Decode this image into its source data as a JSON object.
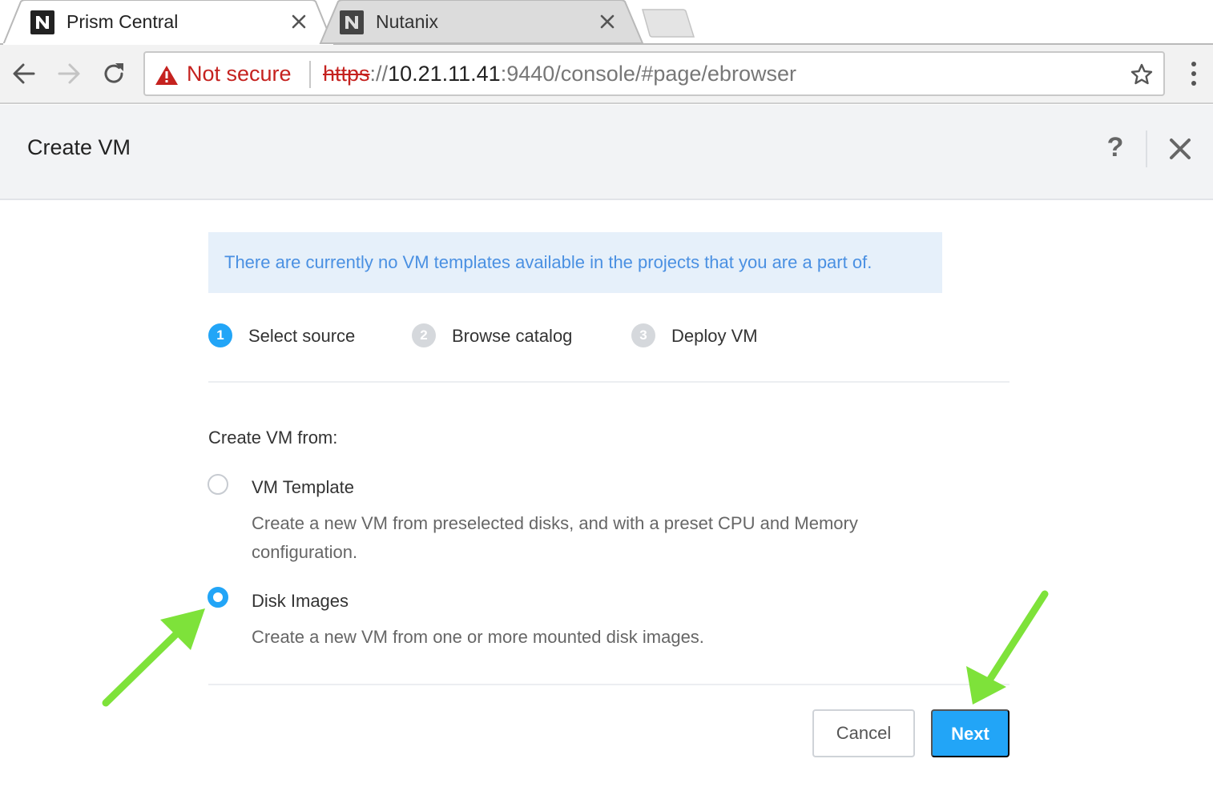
{
  "browser": {
    "tabs": [
      {
        "title": "Prism Central",
        "active": true
      },
      {
        "title": "Nutanix",
        "active": false
      }
    ],
    "omnibox": {
      "security_label": "Not secure",
      "url_scheme": "https",
      "url_sep": "://",
      "url_host": "10.21.11.41",
      "url_rest": ":9440/console/#page/ebrowser"
    }
  },
  "dialog": {
    "title": "Create VM",
    "help_label": "?",
    "info_banner": "There are currently no VM templates available in the projects that you are a part of.",
    "steps": [
      {
        "number": "1",
        "label": "Select source",
        "active": true
      },
      {
        "number": "2",
        "label": "Browse catalog",
        "active": false
      },
      {
        "number": "3",
        "label": "Deploy VM",
        "active": false
      }
    ],
    "create_from_label": "Create VM from:",
    "options": [
      {
        "title": "VM Template",
        "description": "Create a new VM from preselected disks, and with a preset CPU and Memory configuration.",
        "selected": false
      },
      {
        "title": "Disk Images",
        "description": "Create a new VM from one or more mounted disk images.",
        "selected": true
      }
    ],
    "buttons": {
      "cancel": "Cancel",
      "next": "Next"
    }
  },
  "colors": {
    "accent": "#22a5f7",
    "info_text": "#4a90e2",
    "info_bg": "#e6f0fa",
    "warning_red": "#c5221f",
    "annotation_arrow": "#7ee23a",
    "step_inactive": "#d5d8dc"
  }
}
